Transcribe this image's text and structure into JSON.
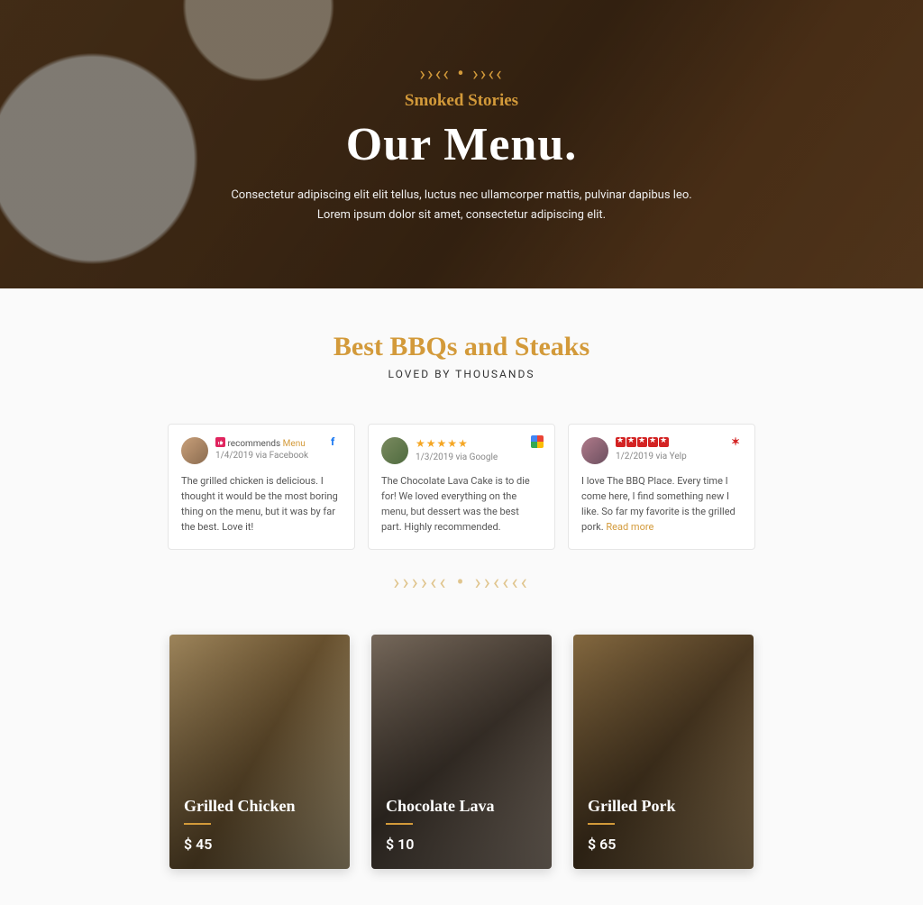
{
  "hero": {
    "eyebrow": "Smoked Stories",
    "title": "Our Menu.",
    "description": "Consectetur adipiscing elit elit tellus, luctus nec ullamcorper mattis, pulvinar dapibus leo. Lorem ipsum dolor sit amet, consectetur adipiscing elit."
  },
  "section": {
    "title": "Best BBQs and Steaks",
    "subtitle": "LOVED BY THOUSANDS"
  },
  "reviews": [
    {
      "source": "facebook",
      "recommends_prefix": "recommends",
      "recommends_link": "Menu",
      "meta": "1/4/2019 via Facebook",
      "text": "The grilled chicken is delicious. I thought it would be the most boring thing on the menu, but it was by far the best. Love it!"
    },
    {
      "source": "google",
      "stars": "★★★★★",
      "meta": "1/3/2019 via Google",
      "text": "The Chocolate Lava Cake is to die for! We loved everything on the menu, but dessert was the best part. Highly recommended."
    },
    {
      "source": "yelp",
      "meta": "1/2/2019 via Yelp",
      "text": "I love The BBQ Place. Every time I come here, I find something new I like. So far my favorite is the grilled pork.",
      "read_more": "Read more"
    }
  ],
  "menu_items": [
    {
      "name": "Grilled Chicken",
      "price": "$ 45"
    },
    {
      "name": "Chocolate Lava",
      "price": "$ 10"
    },
    {
      "name": "Grilled Pork",
      "price": "$ 65"
    }
  ]
}
